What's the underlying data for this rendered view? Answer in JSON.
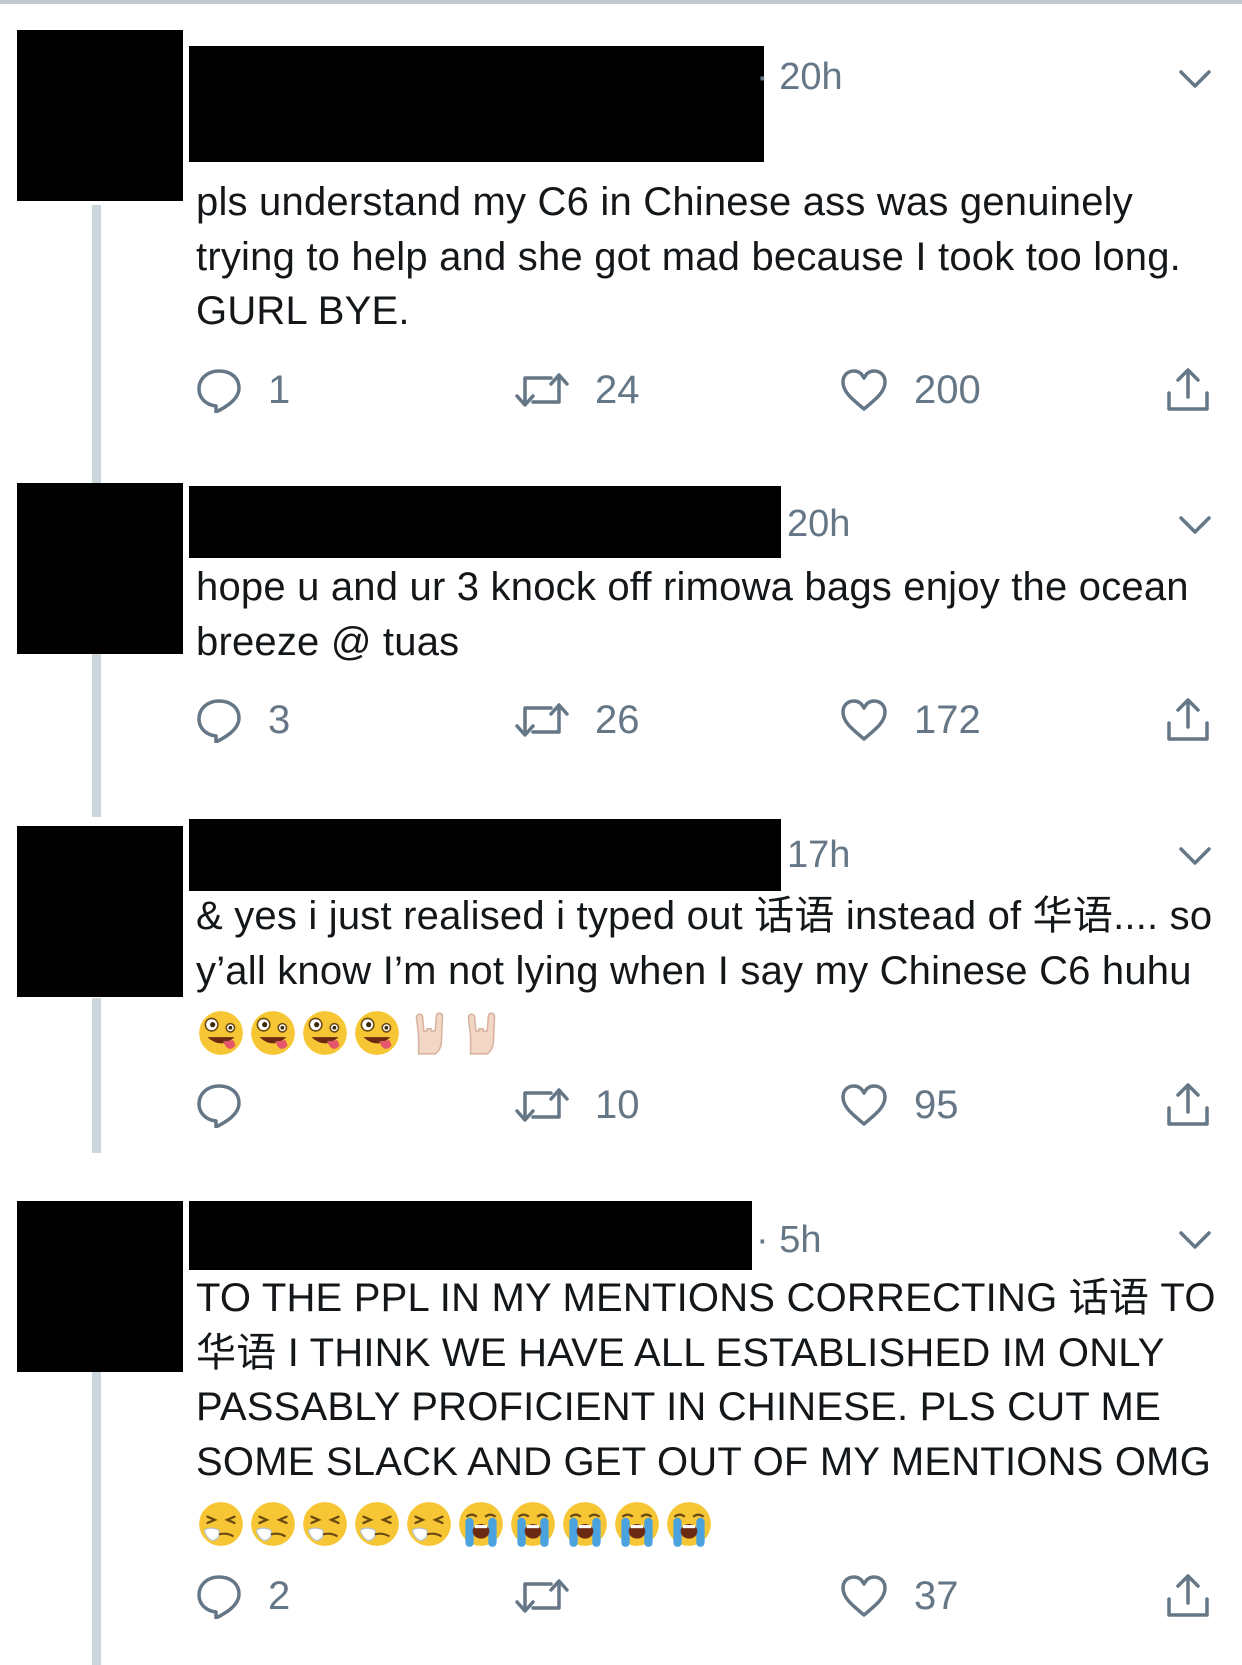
{
  "tweets": [
    {
      "time": "20h",
      "time_prefix": "·",
      "text": "pls understand my C6 in Chinese ass was genuinely trying to help and she got mad because I took too long. GURL BYE.",
      "emojis": [],
      "replies": "1",
      "retweets": "24",
      "likes": "200"
    },
    {
      "time": "20h",
      "time_prefix": "",
      "text": "hope u and ur 3 knock off rimowa bags enjoy the ocean breeze @ tuas",
      "emojis": [],
      "replies": "3",
      "retweets": "26",
      "likes": "172"
    },
    {
      "time": "17h",
      "time_prefix": "",
      "text": "& yes i just realised i typed out 话语 instead of 华语.... so y’all know I’m not lying when I say my Chinese C6 huhu",
      "emojis": [
        "zany-face-emoji",
        "zany-face-emoji",
        "zany-face-emoji",
        "zany-face-emoji",
        "rock-on-hand-emoji",
        "rock-on-hand-emoji"
      ],
      "replies": "",
      "retweets": "10",
      "likes": "95"
    },
    {
      "time": "5h",
      "time_prefix": "·",
      "text": "TO THE PPL IN MY MENTIONS CORRECTING 话语 TO 华语 I THINK WE HAVE ALL ESTABLISHED IM ONLY PASSABLY PROFICIENT IN CHINESE. PLS CUT ME SOME SLACK AND GET OUT OF MY MENTIONS OMG",
      "emojis": [
        "sneezing-face-emoji",
        "sneezing-face-emoji",
        "sneezing-face-emoji",
        "sneezing-face-emoji",
        "sneezing-face-emoji",
        "loudly-crying-face-emoji",
        "loudly-crying-face-emoji",
        "loudly-crying-face-emoji",
        "loudly-crying-face-emoji",
        "loudly-crying-face-emoji"
      ],
      "replies": "2",
      "retweets": "",
      "likes": "37"
    }
  ],
  "colors": {
    "text": "#14171a",
    "muted": "#657786",
    "thread_line": "#ccd6dd",
    "redaction": "#000000"
  },
  "icons": {
    "reply": "speech-bubble-icon",
    "retweet": "retweet-arrows-icon",
    "like": "heart-outline-icon",
    "share": "share-upload-icon",
    "more": "chevron-down-icon"
  }
}
